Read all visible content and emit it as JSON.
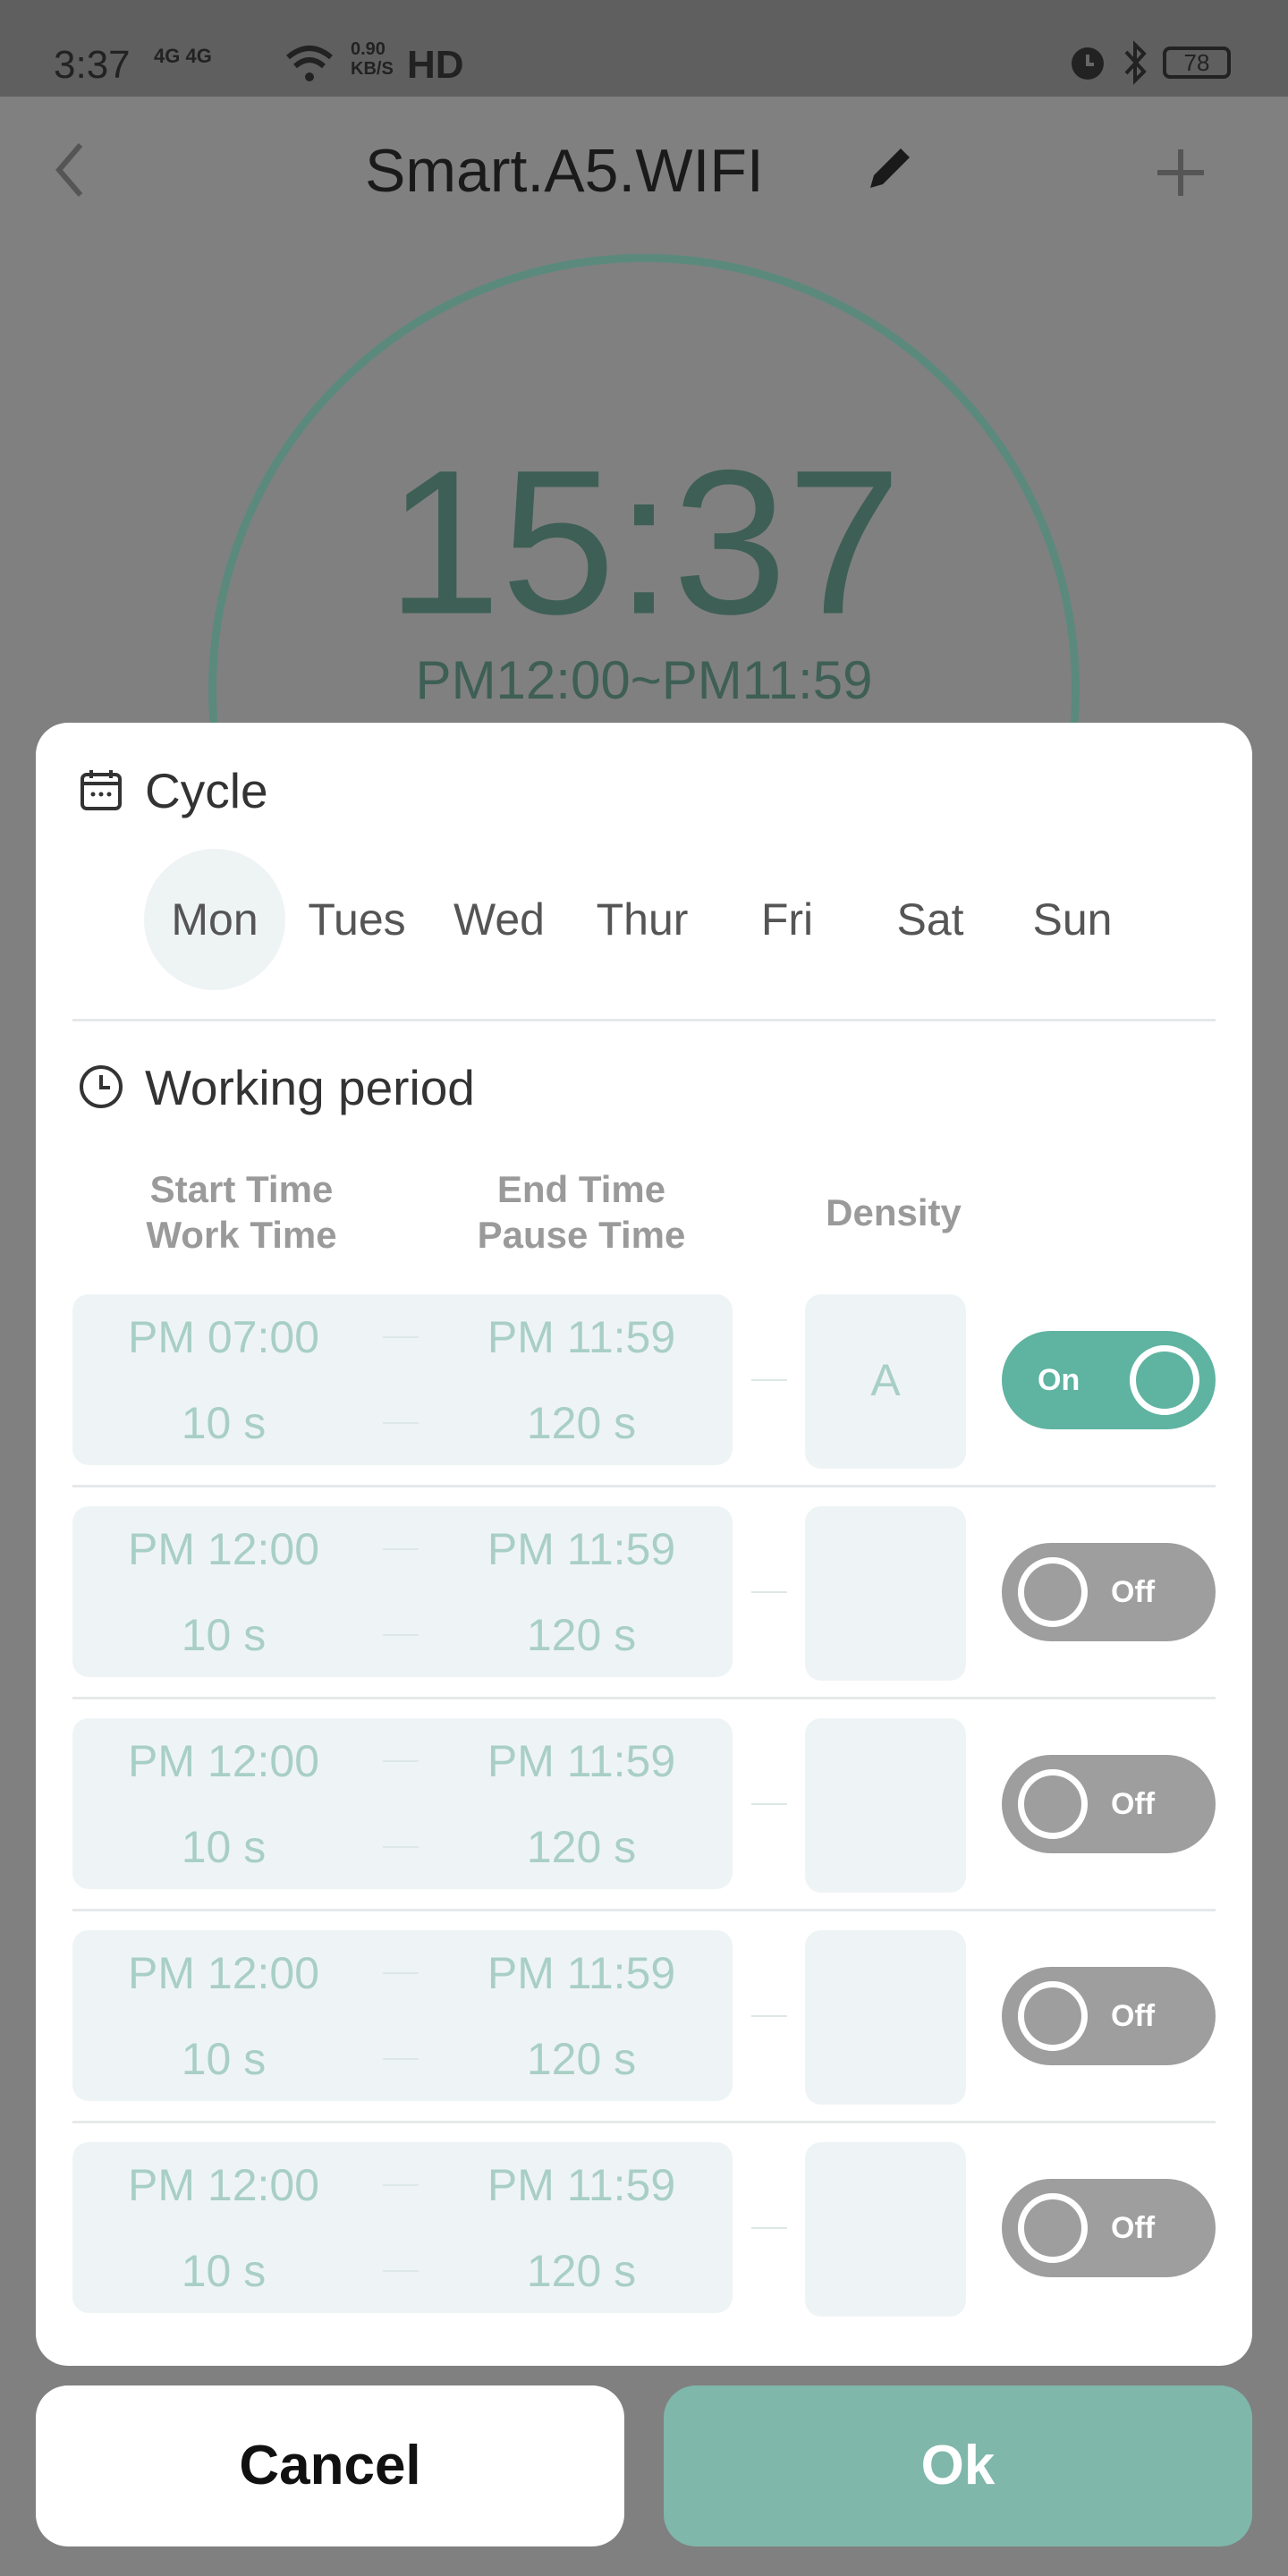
{
  "status_bar": {
    "time": "3:37",
    "network": "4G 4G",
    "speed_value": "0.90",
    "speed_unit": "KB/S",
    "hd": "HD",
    "battery": "78"
  },
  "header": {
    "title": "Smart.A5.WIFI",
    "back_icon": "chevron-left-icon",
    "edit_icon": "pencil-icon",
    "add_icon": "plus-icon"
  },
  "clock": {
    "time": "15:37",
    "range": "PM12:00~PM11:59"
  },
  "cycle": {
    "title": "Cycle",
    "days": [
      "Mon",
      "Tues",
      "Wed",
      "Thur",
      "Fri",
      "Sat",
      "Sun"
    ],
    "selected": "Mon"
  },
  "working_period": {
    "title": "Working period",
    "headers": {
      "start": "Start Time",
      "work": "Work Time",
      "end": "End Time",
      "pause": "Pause Time",
      "density": "Density"
    },
    "rows": [
      {
        "start": "PM 07:00",
        "end": "PM 11:59",
        "work": "10 s",
        "pause": "120 s",
        "density": "A",
        "toggle": "On",
        "on": true
      },
      {
        "start": "PM 12:00",
        "end": "PM 11:59",
        "work": "10 s",
        "pause": "120 s",
        "density": "",
        "toggle": "Off",
        "on": false
      },
      {
        "start": "PM 12:00",
        "end": "PM 11:59",
        "work": "10 s",
        "pause": "120 s",
        "density": "",
        "toggle": "Off",
        "on": false
      },
      {
        "start": "PM 12:00",
        "end": "PM 11:59",
        "work": "10 s",
        "pause": "120 s",
        "density": "",
        "toggle": "Off",
        "on": false
      },
      {
        "start": "PM 12:00",
        "end": "PM 11:59",
        "work": "10 s",
        "pause": "120 s",
        "density": "",
        "toggle": "Off",
        "on": false
      }
    ]
  },
  "buttons": {
    "cancel": "Cancel",
    "ok": "Ok"
  },
  "colors": {
    "accent": "#5fb3a1",
    "ok_button": "#7fb7aa",
    "toggle_off": "#9e9e9e"
  }
}
